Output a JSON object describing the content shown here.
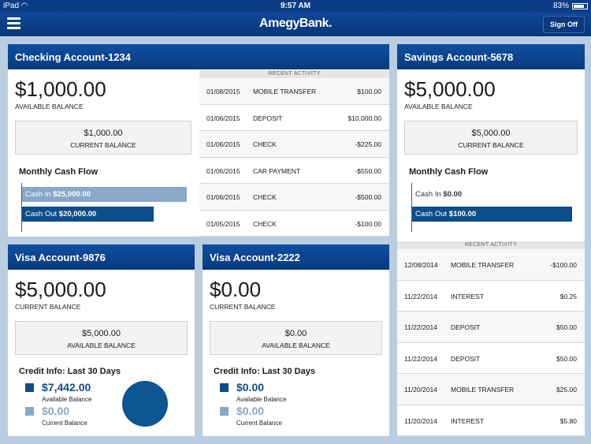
{
  "status_bar": {
    "device": "iPad",
    "time": "9:57 AM",
    "battery": "83%",
    "battery_level": 0.83
  },
  "app_bar": {
    "brand": "AmegyBank.",
    "sign_off": "Sign Off"
  },
  "labels": {
    "available_balance": "AVAILABLE BALANCE",
    "current_balance": "CURRENT BALANCE",
    "recent_activity": "RECENT ACTIVITY",
    "monthly_cash_flow": "Monthly Cash Flow",
    "credit_info": "Credit Info: Last 30 Days",
    "cash_in": "Cash In",
    "cash_out": "Cash Out",
    "available_balance_small": "Available Balance",
    "current_balance_small": "Current Balance"
  },
  "colors": {
    "header": "#0b3d86",
    "cash_in": "#88a8c6",
    "cash_out": "#0d4d8b",
    "legend_available": "#0d4d8b",
    "legend_current": "#88a8c6"
  },
  "checking": {
    "title": "Checking Account-1234",
    "available": "$1,000.00",
    "current": "$1,000.00",
    "cash_in": "$25,000.00",
    "cash_out": "$20,000.00",
    "cash_in_value": 25000,
    "cash_out_value": 20000,
    "activity": [
      {
        "date": "01/08/2015",
        "desc": "MOBILE TRANSFER",
        "amount": "$100.00"
      },
      {
        "date": "01/06/2015",
        "desc": "DEPOSIT",
        "amount": "$10,000.00"
      },
      {
        "date": "01/06/2015",
        "desc": "CHECK",
        "amount": "-$225.00"
      },
      {
        "date": "01/06/2015",
        "desc": "CAR PAYMENT",
        "amount": "-$550.00"
      },
      {
        "date": "01/06/2015",
        "desc": "CHECK",
        "amount": "-$500.00"
      },
      {
        "date": "01/05/2015",
        "desc": "CHECK",
        "amount": "-$100.00"
      }
    ]
  },
  "savings": {
    "title": "Savings Account-5678",
    "available": "$5,000.00",
    "current": "$5,000.00",
    "cash_in": "$0.00",
    "cash_out": "$100.00",
    "cash_in_value": 0,
    "cash_out_value": 100,
    "activity": [
      {
        "date": "12/08/2014",
        "desc": "MOBILE TRANSFER",
        "amount": "-$100.00"
      },
      {
        "date": "11/22/2014",
        "desc": "INTEREST",
        "amount": "$0.25"
      },
      {
        "date": "11/22/2014",
        "desc": "DEPOSIT",
        "amount": "$50.00"
      },
      {
        "date": "11/22/2014",
        "desc": "DEPOSIT",
        "amount": "$50.00"
      },
      {
        "date": "11/20/2014",
        "desc": "MOBILE TRANSFER",
        "amount": "$25.00"
      },
      {
        "date": "11/20/2014",
        "desc": "INTEREST",
        "amount": "$5.80"
      }
    ]
  },
  "visa9876": {
    "title": "Visa Account-9876",
    "current": "$5,000.00",
    "available": "$5,000.00",
    "credit_available": "$7,442.00",
    "credit_current": "$0.00"
  },
  "visa2222": {
    "title": "Visa Account-2222",
    "current": "$0.00",
    "available": "$0.00",
    "credit_available": "$0.00",
    "credit_current": "$0.00"
  }
}
